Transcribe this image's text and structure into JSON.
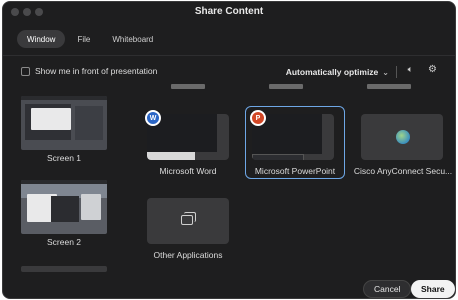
{
  "window": {
    "title": "Share Content"
  },
  "tabs": [
    {
      "label": "Window",
      "active": true
    },
    {
      "label": "File",
      "active": false
    },
    {
      "label": "Whiteboard",
      "active": false
    }
  ],
  "options": {
    "show_me_label": "Show me in front of presentation",
    "optimize_label": "Automatically optimize"
  },
  "screens": [
    {
      "label": "Screen 1"
    },
    {
      "label": "Screen 2"
    }
  ],
  "apps": [
    {
      "label": "Microsoft Word",
      "icon": "word-icon",
      "badge": "W",
      "color": "#2b66c6"
    },
    {
      "label": "Microsoft PowerPoint",
      "icon": "powerpoint-icon",
      "badge": "P",
      "color": "#d24726"
    },
    {
      "label": "Cisco AnyConnect Secu...",
      "icon": "globe-icon"
    },
    {
      "label": "Other Applications",
      "icon": "stacked-windows-icon"
    }
  ],
  "buttons": {
    "cancel": "Cancel",
    "share": "Share"
  },
  "colors": {
    "background": "#1e1e1f",
    "selection": "#6ea7e6"
  }
}
